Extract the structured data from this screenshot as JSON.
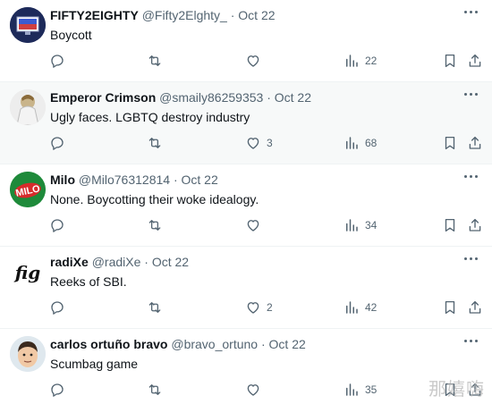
{
  "tweets": [
    {
      "name": "FIFTY2EIGHTY",
      "handle": "@Fifty2Elghty_",
      "date": "Oct 22",
      "text": "Boycott",
      "replies": "",
      "retweets": "",
      "likes": "",
      "views": "22",
      "avatar_icon": "flag-screen-avatar"
    },
    {
      "name": "Emperor Crimson",
      "handle": "@smaily86259353",
      "date": "Oct 22",
      "text": "Ugly faces. LGBTQ destroy industry",
      "replies": "",
      "retweets": "",
      "likes": "3",
      "views": "68",
      "avatar_icon": "robed-figure-avatar"
    },
    {
      "name": "Milo",
      "handle": "@Milo76312814",
      "date": "Oct 22",
      "text": "None. Boycotting their woke idealogy.",
      "replies": "",
      "retweets": "",
      "likes": "",
      "views": "34",
      "avatar_icon": "milo-logo-avatar",
      "avatar_text": "MILO"
    },
    {
      "name": "radiXe",
      "handle": "@radiXe",
      "date": "Oct 22",
      "text": "Reeks of SBI.",
      "replies": "",
      "retweets": "",
      "likes": "2",
      "views": "42",
      "avatar_icon": "gothic-monogram-avatar",
      "avatar_text": "fig"
    },
    {
      "name": "carlos ortuño bravo",
      "handle": "@bravo_ortuno",
      "date": "Oct 22",
      "text": "Scumbag game",
      "replies": "",
      "retweets": "",
      "likes": "",
      "views": "35",
      "avatar_icon": "cartoon-face-avatar"
    }
  ],
  "separator": "·",
  "watermark": "那嬉嗨",
  "colors": {
    "text": "#0f1419",
    "muted": "#536471",
    "divider": "#eff3f4",
    "highlight": "#f7f9f9",
    "milo_green": "#1e8a3a"
  }
}
